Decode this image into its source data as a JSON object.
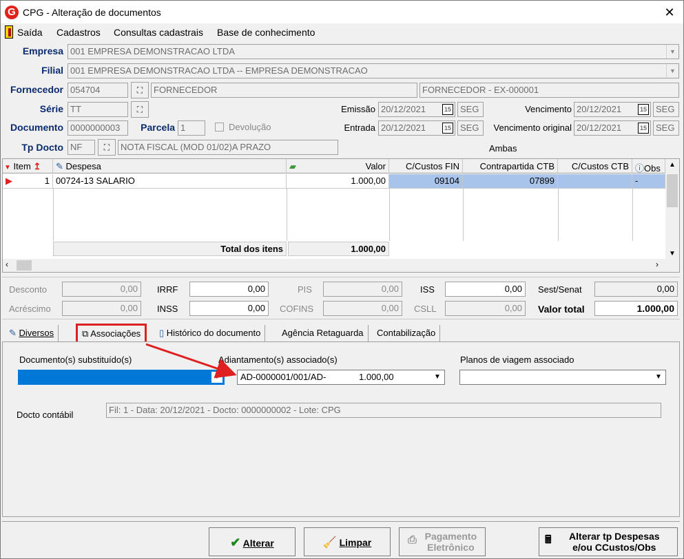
{
  "window": {
    "title": "CPG - Alteração de documentos",
    "logo": "G",
    "close": "✕"
  },
  "menu": [
    "Saída",
    "Cadastros",
    "Consultas cadastrais",
    "Base de conhecimento"
  ],
  "header": {
    "empresa_label": "Empresa",
    "empresa_value": "001 EMPRESA DEMONSTRACAO LTDA",
    "filial_label": "Filial",
    "filial_value": "001 EMPRESA DEMONSTRACAO LTDA -- EMPRESA DEMONSTRACAO",
    "fornecedor_label": "Fornecedor",
    "fornecedor_code": "054704",
    "fornecedor_name": "FORNECEDOR",
    "fornecedor_desc": "FORNECEDOR - EX-000001",
    "serie_label": "Série",
    "serie_value": "TT",
    "emissao_label": "Emissão",
    "emissao_value": "20/12/2021",
    "emissao_day": "SEG",
    "vencimento_label": "Vencimento",
    "vencimento_value": "20/12/2021",
    "vencimento_day": "SEG",
    "documento_label": "Documento",
    "documento_value": "0000000003",
    "parcela_label": "Parcela",
    "parcela_value": "1",
    "devolucao_label": "Devolução",
    "entrada_label": "Entrada",
    "entrada_value": "20/12/2021",
    "entrada_day": "SEG",
    "venc_original_label": "Vencimento original",
    "venc_original_value": "20/12/2021",
    "venc_original_day": "SEG",
    "tpdocto_label": "Tp Docto",
    "tpdocto_code": "NF",
    "tpdocto_desc": "NOTA FISCAL (MOD 01/02)A PRAZO",
    "ambas": "Ambas",
    "cal_glyph": "15"
  },
  "grid": {
    "headers": {
      "item": "Item",
      "despesa": "Despesa",
      "valor": "Valor",
      "ccustos_fin": "C/Custos FIN",
      "contrapartida": "Contrapartida CTB",
      "ccustos_ctb": "C/Custos CTB",
      "obs": "Obs"
    },
    "rows": [
      {
        "item": "1",
        "despesa": "00724-13 SALARIO",
        "valor": "1.000,00",
        "ccustos_fin": "09104",
        "contrapartida": "07899",
        "ccustos_ctb": "",
        "obs": "-"
      }
    ],
    "total_label": "Total dos itens",
    "total_value": "1.000,00"
  },
  "totals": {
    "desconto_label": "Desconto",
    "desconto": "0,00",
    "irrf_label": "IRRF",
    "irrf": "0,00",
    "pis_label": "PIS",
    "pis": "0,00",
    "iss_label": "ISS",
    "iss": "0,00",
    "sest_label": "Sest/Senat",
    "sest": "0,00",
    "acrescimo_label": "Acréscimo",
    "acrescimo": "0,00",
    "inss_label": "INSS",
    "inss": "0,00",
    "cofins_label": "COFINS",
    "cofins": "0,00",
    "csll_label": "CSLL",
    "csll": "0,00",
    "valor_total_label": "Valor total",
    "valor_total": "1.000,00"
  },
  "tabs": [
    "Diversos",
    "Associações",
    "Histórico do documento",
    "Agência Retaguarda",
    "Contabilização"
  ],
  "associacoes": {
    "doc_subst_label": "Documento(s) substituído(s)",
    "adiant_label": "Adiantamento(s) associado(s)",
    "adiant_value": "AD-0000001/001/AD-",
    "adiant_amount": "1.000,00",
    "planos_label": "Planos de viagem associado",
    "docto_contabil_label": "Docto contábil",
    "docto_contabil_value": "Fil: 1 - Data: 20/12/2021 - Docto: 0000000002 - Lote: CPG"
  },
  "buttons": {
    "alterar": "Alterar",
    "limpar": "Limpar",
    "pagamento_line1": "Pagamento",
    "pagamento_line2": "Eletrônico",
    "alterar_tp_line1": "Alterar tp Despesas",
    "alterar_tp_line2": "e/ou CCustos/Obs"
  },
  "colors": {
    "accent_label": "#0a2a6e",
    "selection": "#0078d7",
    "row_highlight": "#a9c4ea",
    "annotation_red": "#e02020"
  }
}
